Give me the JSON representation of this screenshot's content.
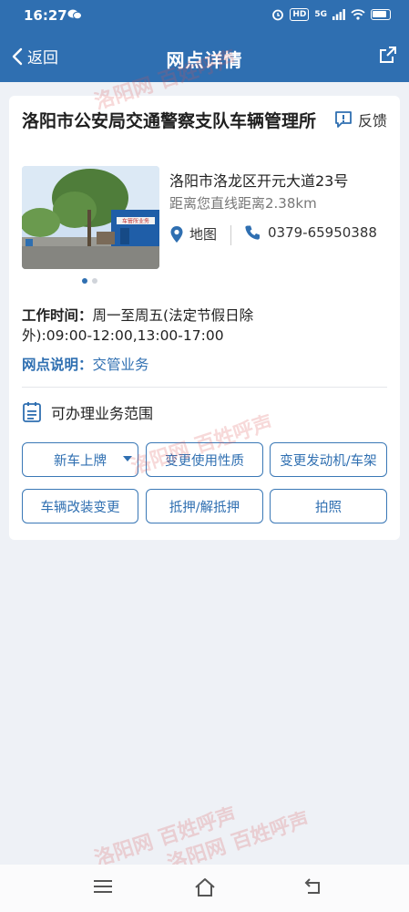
{
  "status_bar": {
    "time": "16:27",
    "network": "5G"
  },
  "nav": {
    "back_label": "返回",
    "title": "网点详情"
  },
  "station": {
    "name": "洛阳市公安局交通警察支队车辆管理所",
    "feedback_label": "反馈",
    "address": "洛阳市洛龙区开元大道23号",
    "distance": "距离您直线距离2.38km",
    "map_label": "地图",
    "phone": "0379-65950388",
    "hours_key": "工作时间：",
    "hours_value": "周一至周五(法定节假日除外):09:00-12:00,13:00-17:00",
    "desc_key": "网点说明：",
    "desc_value": "交管业务",
    "photo_sign_text": "车管所业务",
    "photo_count": 2,
    "photo_active_index": 0
  },
  "scope": {
    "title": "可办理业务范围",
    "buttons": [
      {
        "label": "新车上牌",
        "has_dropdown": true
      },
      {
        "label": "变更使用性质"
      },
      {
        "label": "变更发动机/车架"
      },
      {
        "label": "车辆改装变更"
      },
      {
        "label": "抵押/解抵押"
      },
      {
        "label": "拍照"
      }
    ]
  },
  "watermark": {
    "text_a": "洛阳网",
    "text_b": "百姓呼声"
  },
  "colors": {
    "primary": "#2f6fb1",
    "background": "#eef1f6",
    "card": "#ffffff"
  }
}
